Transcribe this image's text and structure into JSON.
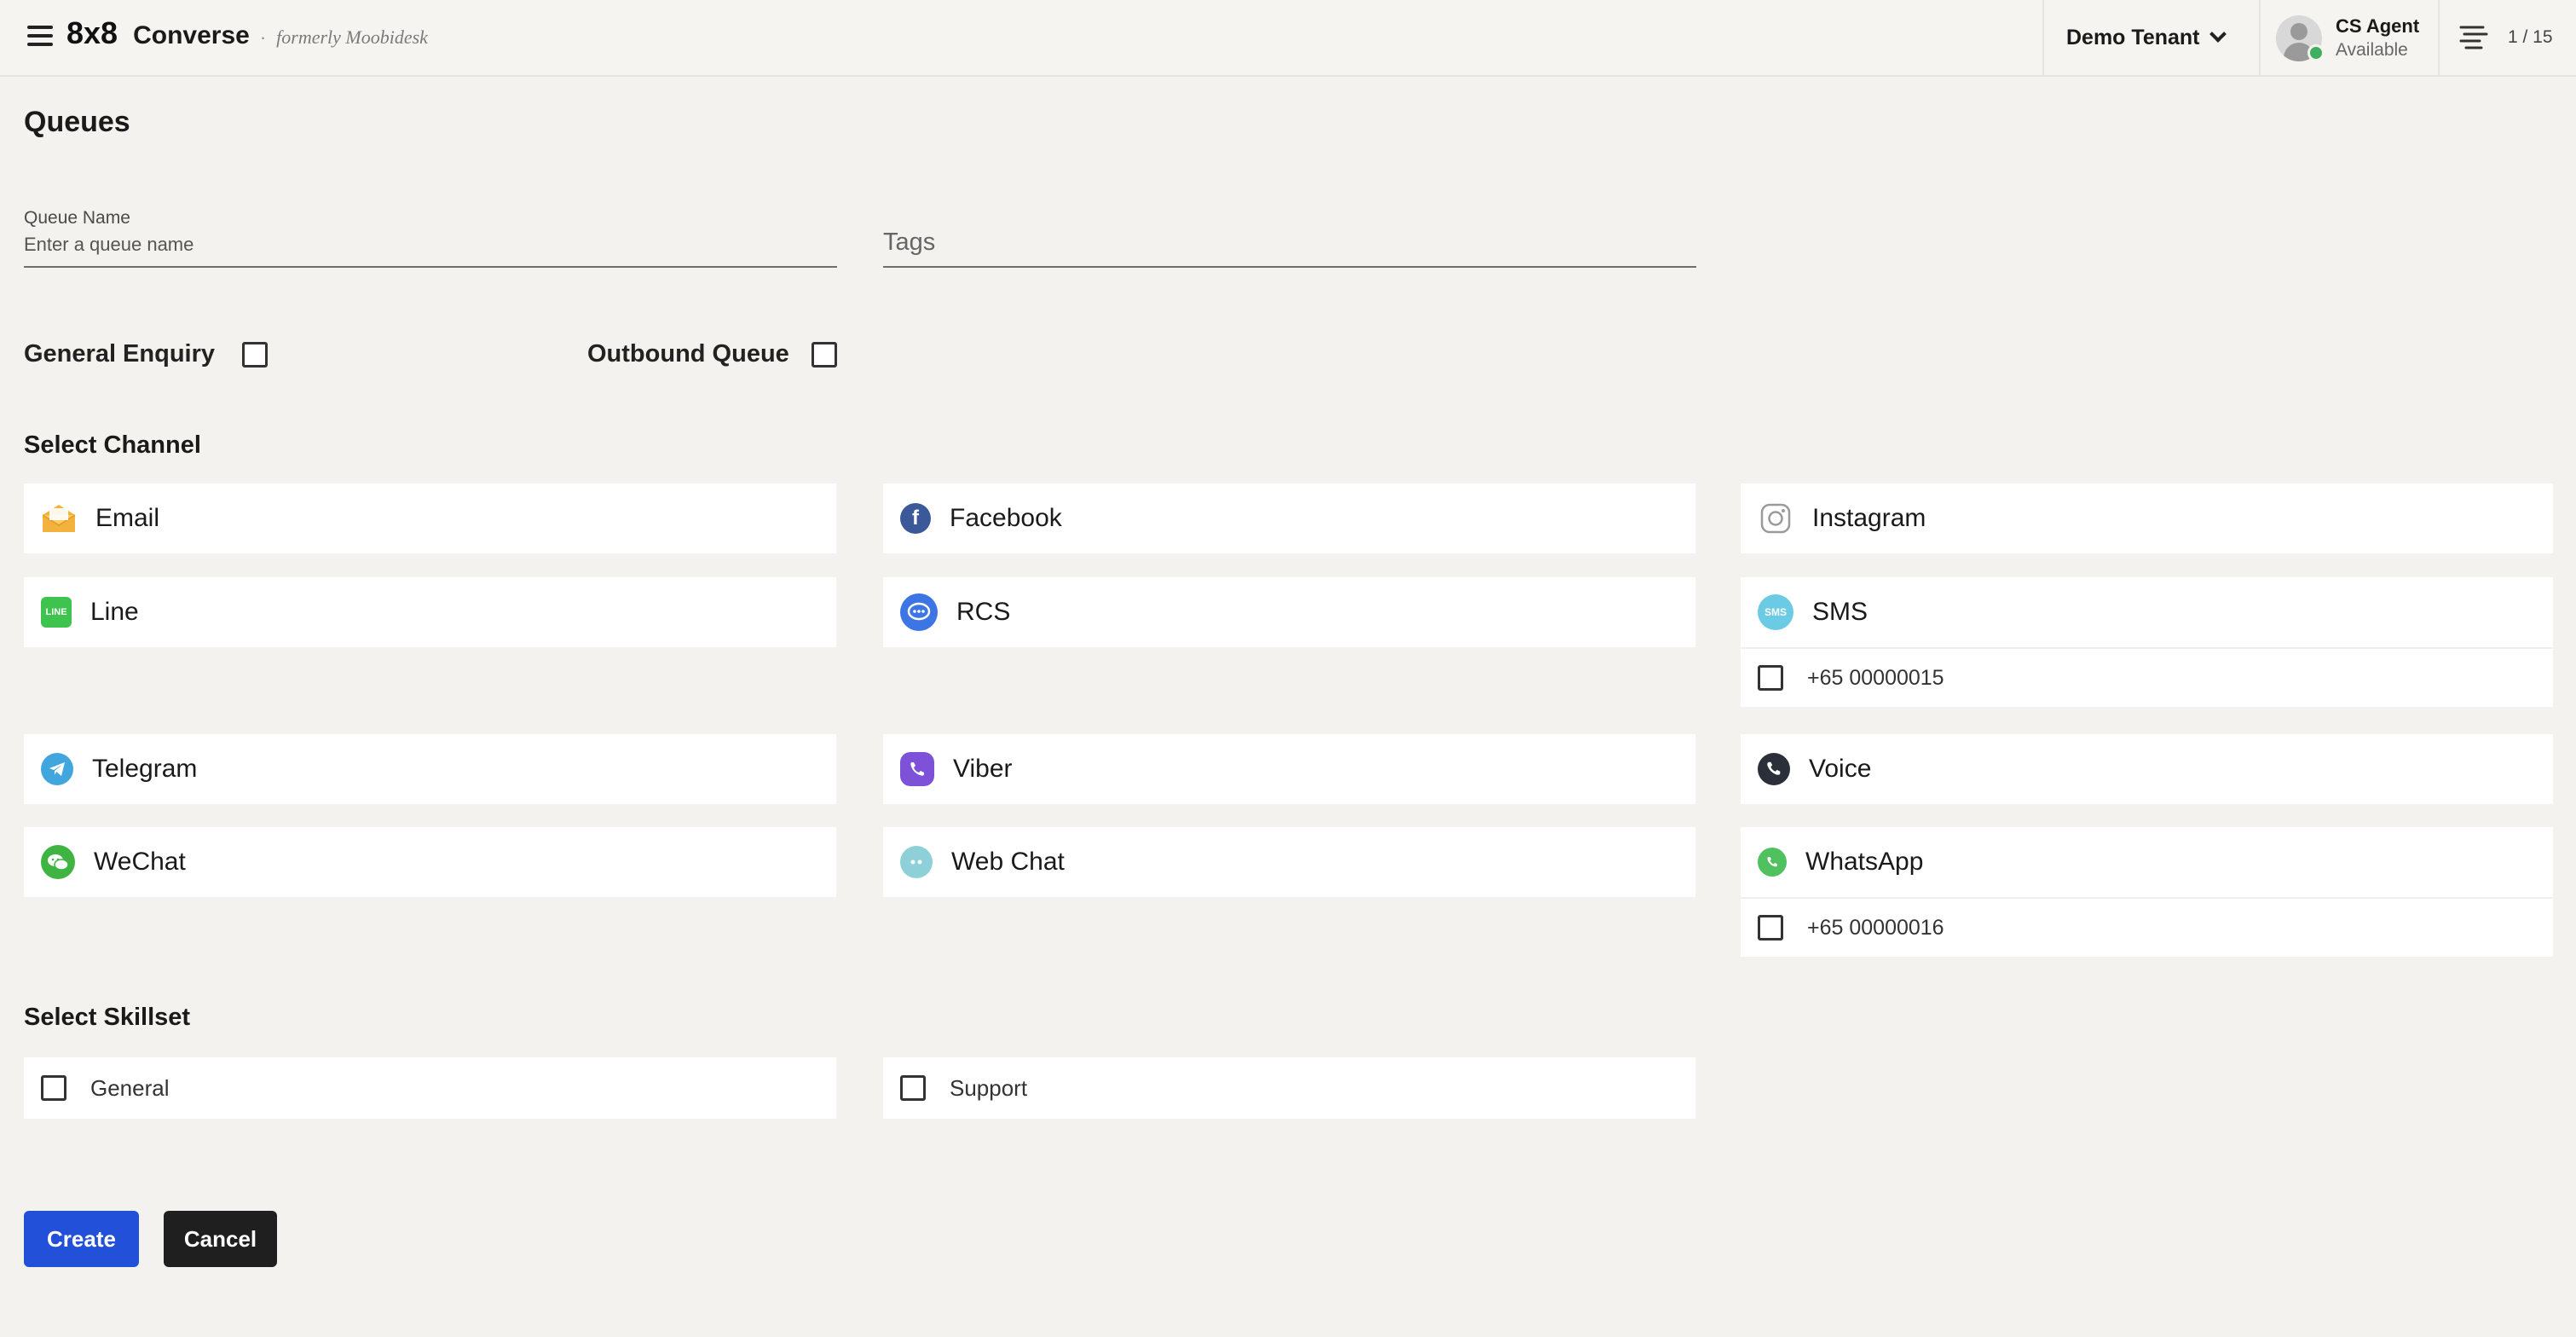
{
  "header": {
    "brand_logo": "8x8",
    "brand_name": "Converse",
    "brand_sep": "·",
    "brand_sub": "formerly Moobidesk",
    "tenant": "Demo Tenant",
    "agent_name": "CS Agent",
    "agent_status": "Available",
    "queue_count": "1 / 15",
    "menu_icon": "hamburger-menu-icon",
    "queue_icon": "queue-list-icon"
  },
  "page": {
    "title": "Queues"
  },
  "form": {
    "queue_name_label": "Queue Name",
    "queue_name_placeholder": "Enter a queue name",
    "queue_name_value": "",
    "tags_placeholder": "Tags",
    "general_enquiry": {
      "label": "General Enquiry",
      "checked": false
    },
    "outbound_queue": {
      "label": "Outbound Queue",
      "checked": false
    }
  },
  "channels": {
    "title": "Select Channel",
    "items": [
      {
        "label": "Email",
        "icon": "envelope-icon"
      },
      {
        "label": "Facebook",
        "icon": "facebook-icon"
      },
      {
        "label": "Instagram",
        "icon": "instagram-icon"
      },
      {
        "label": "Line",
        "icon": "line-icon"
      },
      {
        "label": "RCS",
        "icon": "rcs-chat-icon"
      },
      {
        "label": "SMS",
        "icon": "sms-icon",
        "numbers": [
          "+65 00000015"
        ]
      },
      {
        "label": "Telegram",
        "icon": "telegram-icon"
      },
      {
        "label": "Viber",
        "icon": "viber-icon"
      },
      {
        "label": "Voice",
        "icon": "phone-icon"
      },
      {
        "label": "WeChat",
        "icon": "wechat-icon"
      },
      {
        "label": "Web Chat",
        "icon": "web-chat-icon"
      },
      {
        "label": "WhatsApp",
        "icon": "whatsapp-icon",
        "numbers": [
          "+65 00000016"
        ]
      }
    ]
  },
  "skillset": {
    "title": "Select Skillset",
    "items": [
      {
        "label": "General",
        "checked": false
      },
      {
        "label": "Support",
        "checked": false
      }
    ]
  },
  "actions": {
    "create": "Create",
    "cancel": "Cancel"
  },
  "colors": {
    "primary": "#2350d8",
    "dark_button": "#1f1f1f",
    "background": "#f3f2ee",
    "presence": "#3fb060"
  }
}
